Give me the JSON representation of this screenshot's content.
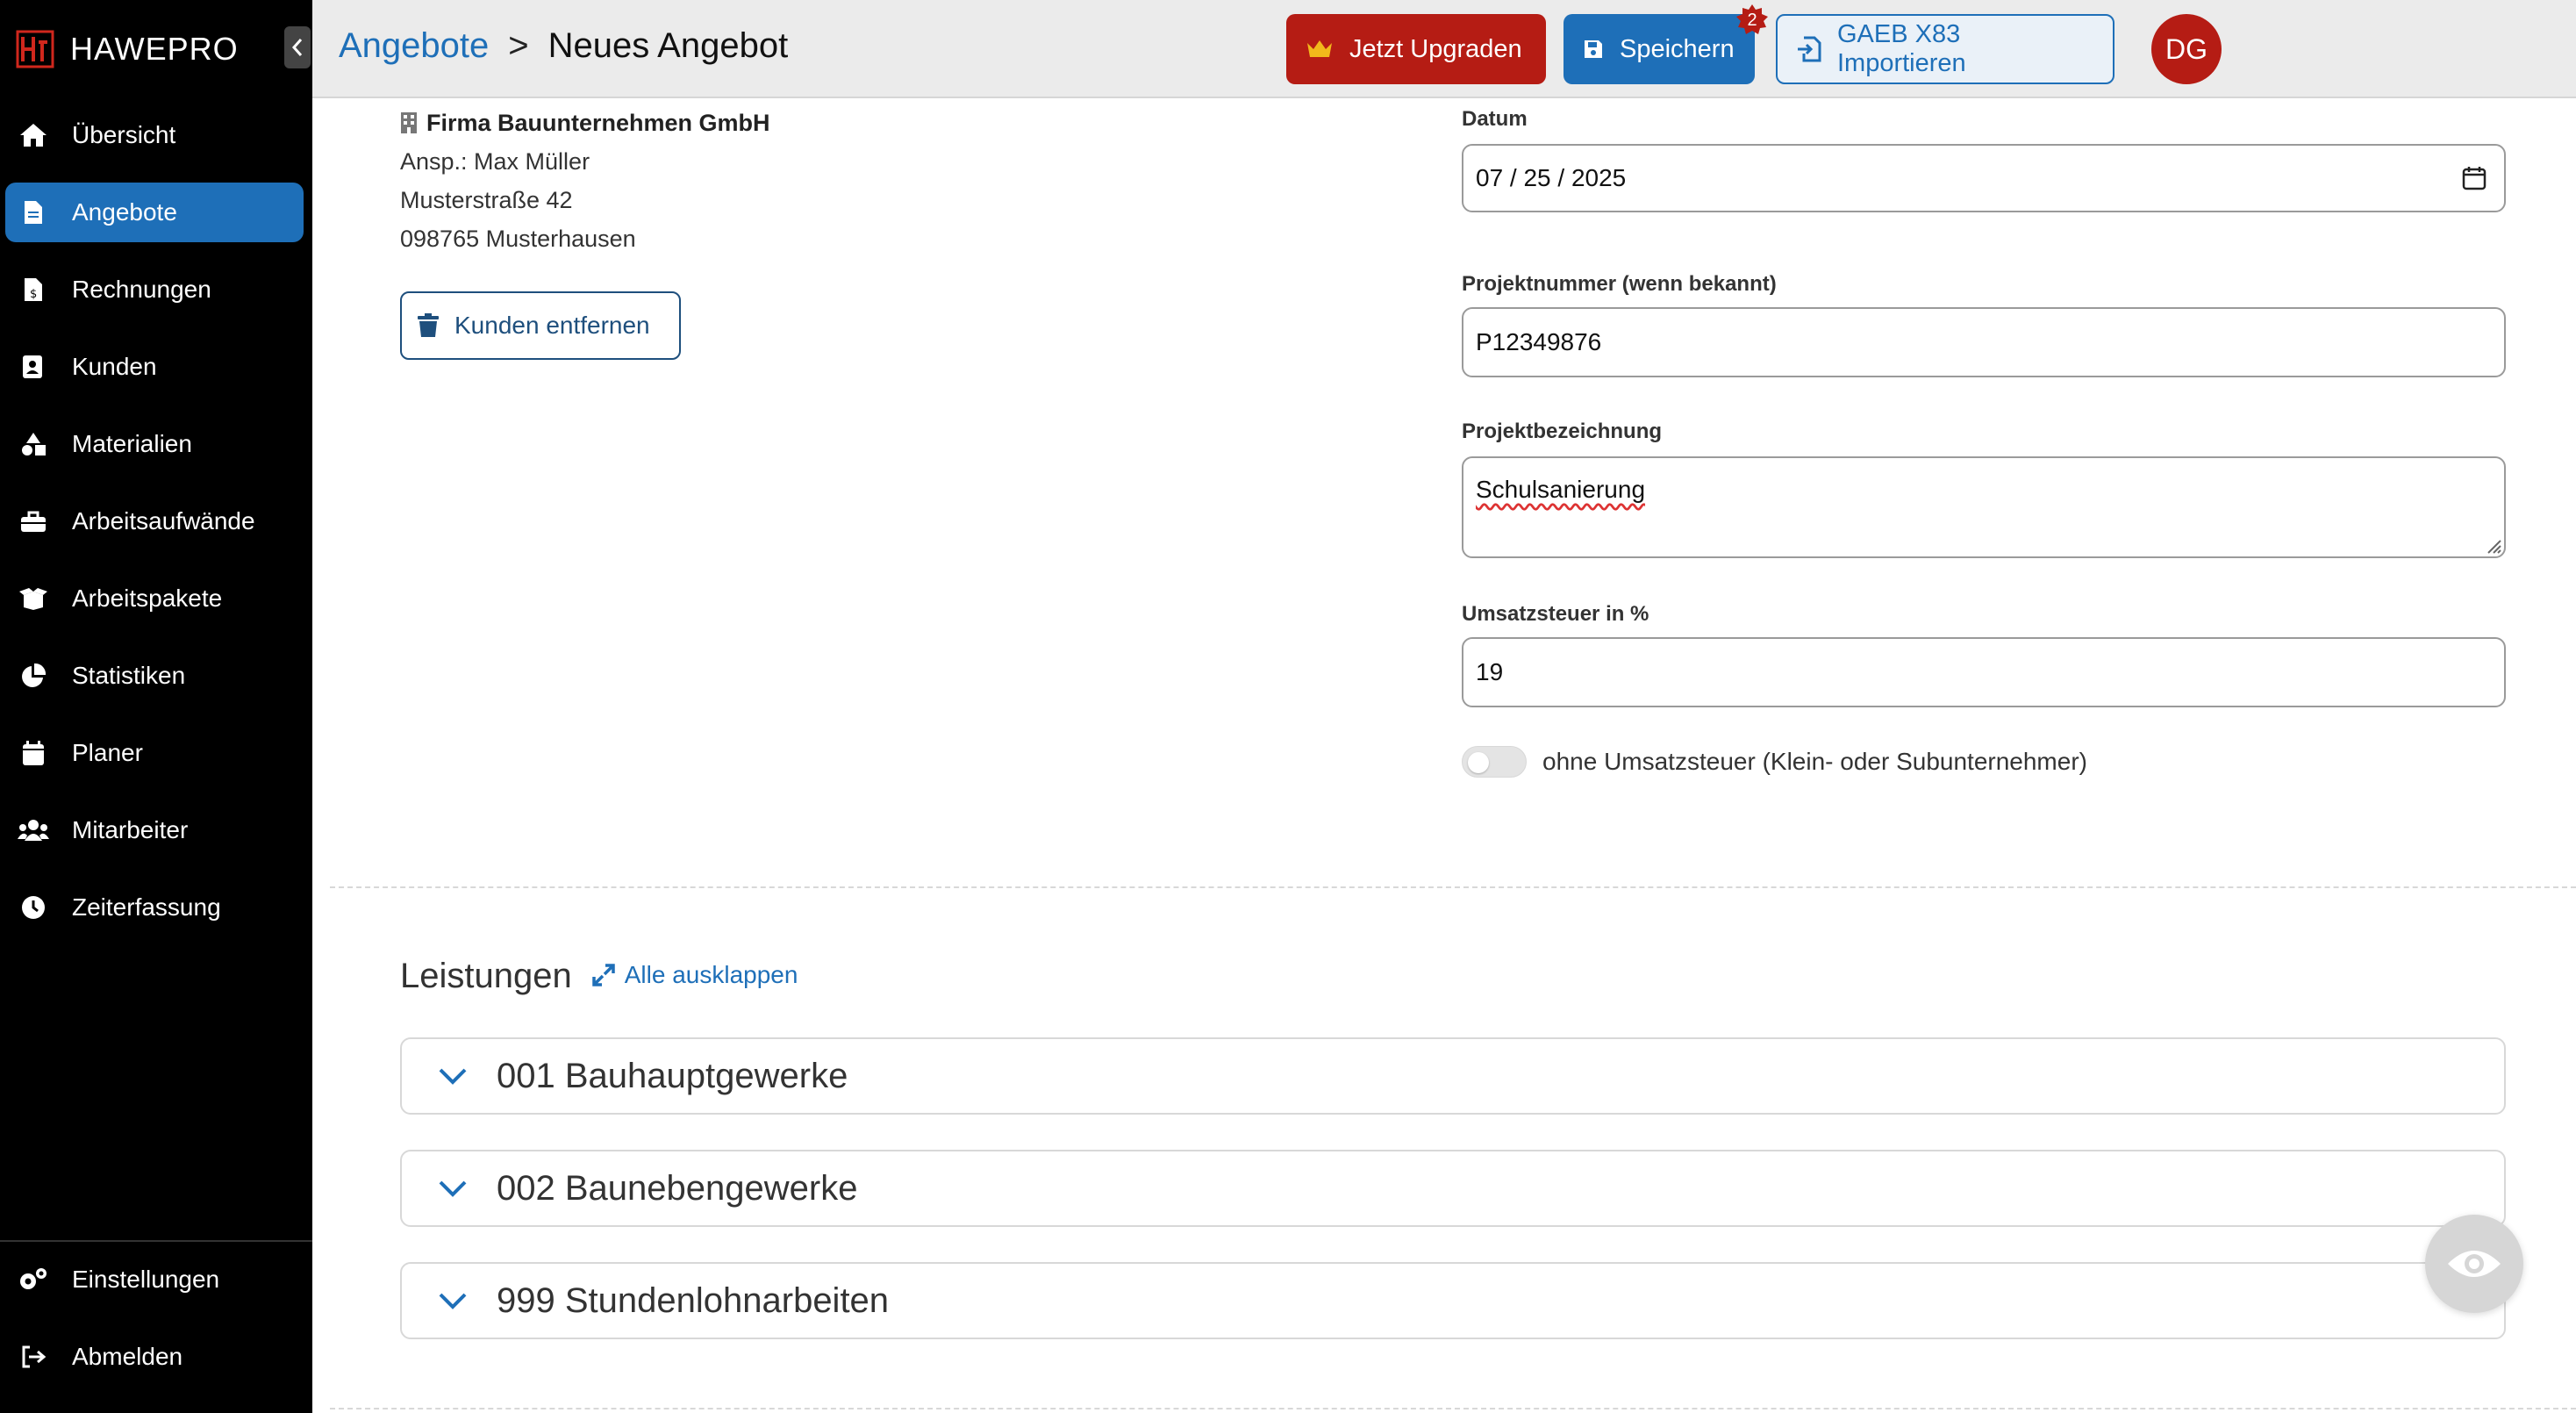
{
  "app": {
    "brand": "HAWEPRO"
  },
  "sidebar": {
    "items": [
      {
        "label": "Übersicht",
        "icon": "home-icon"
      },
      {
        "label": "Angebote",
        "icon": "document-icon",
        "active": true
      },
      {
        "label": "Rechnungen",
        "icon": "invoice-icon"
      },
      {
        "label": "Kunden",
        "icon": "contact-card-icon"
      },
      {
        "label": "Materialien",
        "icon": "shapes-icon"
      },
      {
        "label": "Arbeitsaufwände",
        "icon": "toolbox-icon"
      },
      {
        "label": "Arbeitspakete",
        "icon": "box-open-icon"
      },
      {
        "label": "Statistiken",
        "icon": "pie-chart-icon"
      },
      {
        "label": "Planer",
        "icon": "calendar-icon"
      },
      {
        "label": "Mitarbeiter",
        "icon": "users-icon"
      },
      {
        "label": "Zeiterfassung",
        "icon": "clock-icon"
      }
    ],
    "bottom": [
      {
        "label": "Einstellungen",
        "icon": "gears-icon"
      },
      {
        "label": "Abmelden",
        "icon": "logout-icon"
      }
    ]
  },
  "header": {
    "breadcrumb_parent": "Angebote",
    "breadcrumb_separator": ">",
    "breadcrumb_current": "Neues Angebot",
    "upgrade_label": "Jetzt Upgraden",
    "save_label": "Speichern",
    "save_badge": "2",
    "gaeb_label": "GAEB X83 Importieren",
    "avatar_initials": "DG"
  },
  "customer": {
    "name": "Firma Bauunternehmen GmbH",
    "contact": "Ansp.: Max Müller",
    "street": "Musterstraße 42",
    "city": "098765 Musterhausen",
    "remove_label": "Kunden entfernen"
  },
  "form": {
    "date_label": "Datum",
    "date_value": "07 / 25 / 2025",
    "project_number_label": "Projektnummer (wenn bekannt)",
    "project_number_value": "P12349876",
    "project_name_label": "Projektbezeichnung",
    "project_name_value": "Schulsanierung",
    "vat_label": "Umsatzsteuer in %",
    "vat_value": "19",
    "no_vat_label": "ohne Umsatzsteuer (Klein- oder Subunternehmer)",
    "no_vat_checked": false
  },
  "services": {
    "title": "Leistungen",
    "expand_all_label": "Alle ausklappen",
    "groups": [
      {
        "label": "001 Bauhauptgewerke"
      },
      {
        "label": "002 Baunebengewerke"
      },
      {
        "label": "999 Stundenlohnarbeiten"
      }
    ]
  },
  "colors": {
    "primary": "#1e6fb8",
    "danger": "#b51c14",
    "sidebar": "#000000",
    "header": "#ebebeb"
  },
  "fab": {
    "icon": "eye-icon"
  }
}
